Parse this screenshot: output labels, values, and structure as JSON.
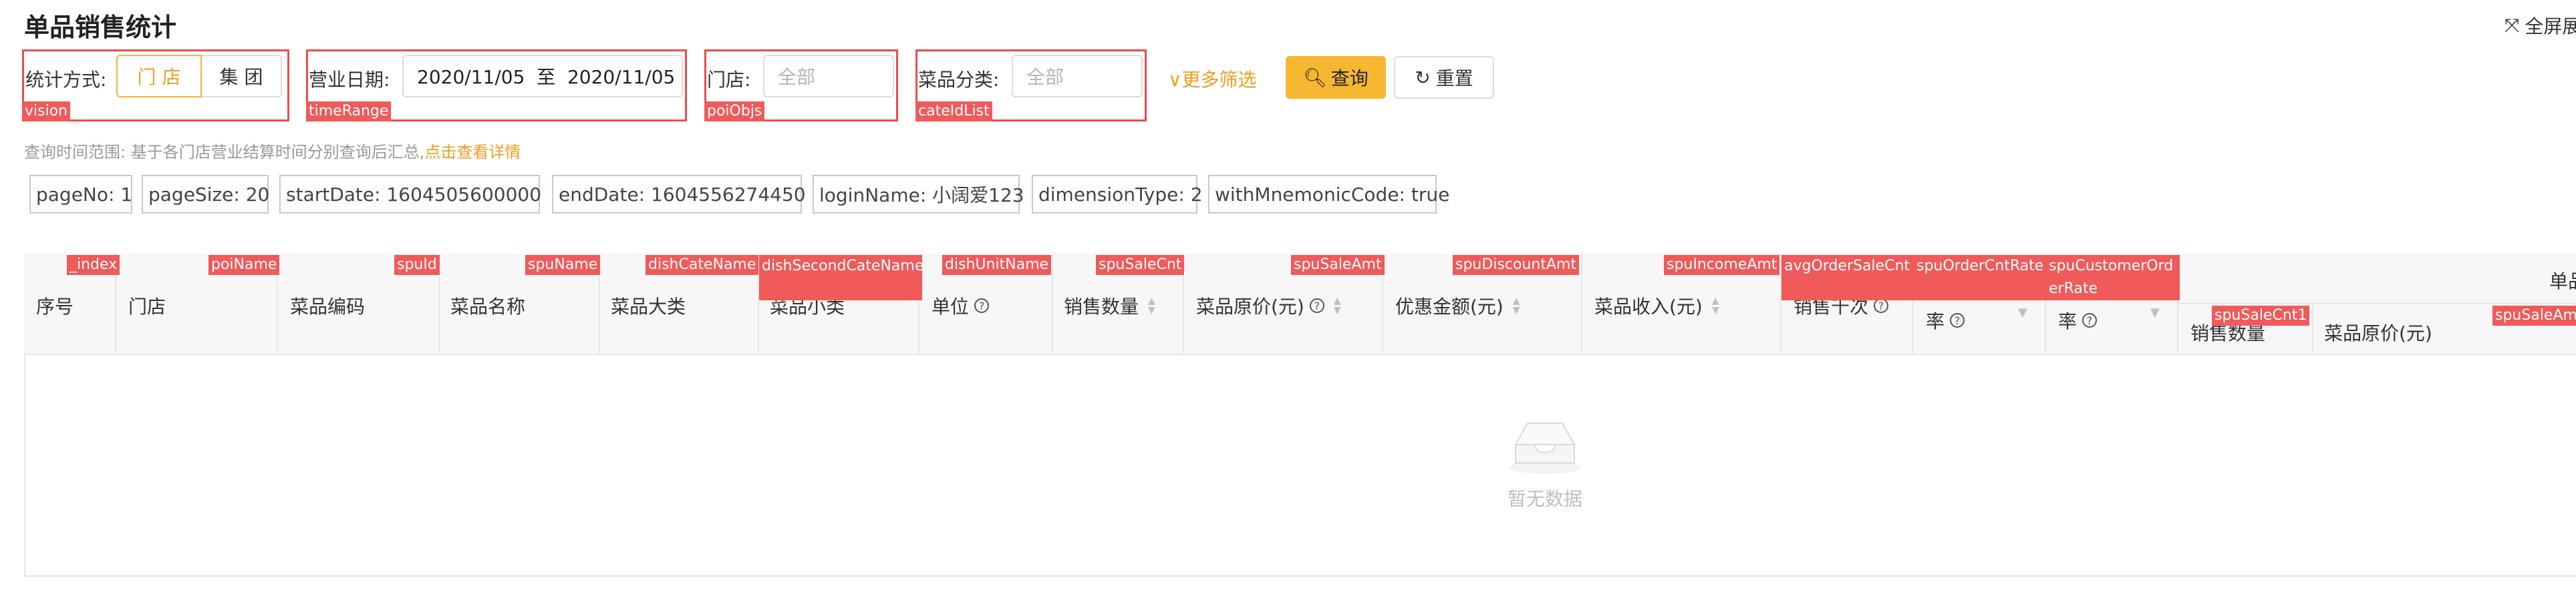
{
  "page": {
    "title": "单品销售统计",
    "fullscreen_label": "全屏展"
  },
  "filters": {
    "vision": {
      "label": "统计方式:",
      "options": [
        "门 店",
        "集 团"
      ],
      "selected": "门 店",
      "tag": "vision"
    },
    "timeRange": {
      "label": "营业日期:",
      "value": "2020/11/05  至  2020/11/05",
      "tag": "timeRange"
    },
    "poiObjs": {
      "label": "门店:",
      "placeholder": "全部",
      "tag": "poiObjs"
    },
    "cateIdList": {
      "label": "菜品分类:",
      "placeholder": "全部",
      "tag": "cateIdList"
    },
    "more_filters": "更多筛选",
    "query_button": "查询",
    "reset_button": "重置"
  },
  "hint": {
    "text": "查询时间范围: 基于各门店营业结算时间分别查询后汇总,",
    "link": "点击查看详情"
  },
  "params": [
    "pageNo: 1",
    "pageSize: 20",
    "startDate: 1604505600000",
    "endDate: 1604556274450",
    "loginName: 小阔爱123",
    "dimensionType: 2",
    "withMnemonicCode: true"
  ],
  "table": {
    "columns": [
      {
        "label": "序号",
        "tag": "_index"
      },
      {
        "label": "门店",
        "tag": "poiName"
      },
      {
        "label": "菜品编码",
        "tag": "spuId"
      },
      {
        "label": "菜品名称",
        "tag": "spuName"
      },
      {
        "label": "菜品大类",
        "tag": "dishCateName"
      },
      {
        "label": "菜品小类",
        "tag": "dishSecondCateName"
      },
      {
        "label": "单位",
        "tag": "dishUnitName"
      },
      {
        "label": "销售数量",
        "tag": "spuSaleCnt"
      },
      {
        "label": "菜品原价(元)",
        "tag": "spuSaleAmt"
      },
      {
        "label": "优惠金额(元)",
        "tag": "spuDiscountAmt"
      },
      {
        "label": "菜品收入(元)",
        "tag": "spuIncomeAmt"
      },
      {
        "label": "销售千次",
        "tag": "avgOrderSaleCnt"
      },
      {
        "label": "率",
        "tag": "spuOrderCntRate"
      },
      {
        "label": "率",
        "tag": "spuCustomerOrderRate"
      }
    ],
    "group_header": "单品",
    "sub_columns": [
      {
        "label": "销售数量",
        "tag": "spuSaleCnt1"
      },
      {
        "label": "菜品原价(元)",
        "tag": "spuSaleAm"
      }
    ],
    "empty_text": "暂无数据"
  }
}
